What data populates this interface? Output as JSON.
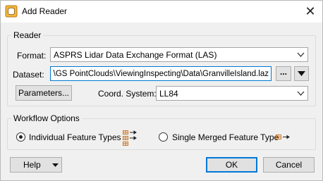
{
  "window": {
    "title": "Add Reader",
    "close_icon": "close-icon",
    "app_icon": "fme-reader-icon"
  },
  "reader": {
    "group_label": "Reader",
    "format_label": "Format:",
    "format_value": "ASPRS Lidar Data Exchange Format (LAS)",
    "dataset_label": "Dataset:",
    "dataset_value": "C:\\FMEData\\Training\\Clouds\\GS PointClouds\\ViewingInspecting\\Data\\GranvilleIsland.laz\"",
    "browse_label": "...",
    "parameters_label": "Parameters...",
    "coord_label": "Coord. System:",
    "coord_value": "LL84"
  },
  "workflow": {
    "group_label": "Workflow Options",
    "options": [
      {
        "label": "Individual Feature Types",
        "selected": true,
        "icon": "individual-feature-types-icon"
      },
      {
        "label": "Single Merged Feature Type",
        "selected": false,
        "icon": "single-merged-feature-type-icon"
      }
    ]
  },
  "footer": {
    "help_label": "Help",
    "ok_label": "OK",
    "cancel_label": "Cancel"
  },
  "colors": {
    "accent": "#0078d7",
    "icon_orange": "#c8782a"
  }
}
